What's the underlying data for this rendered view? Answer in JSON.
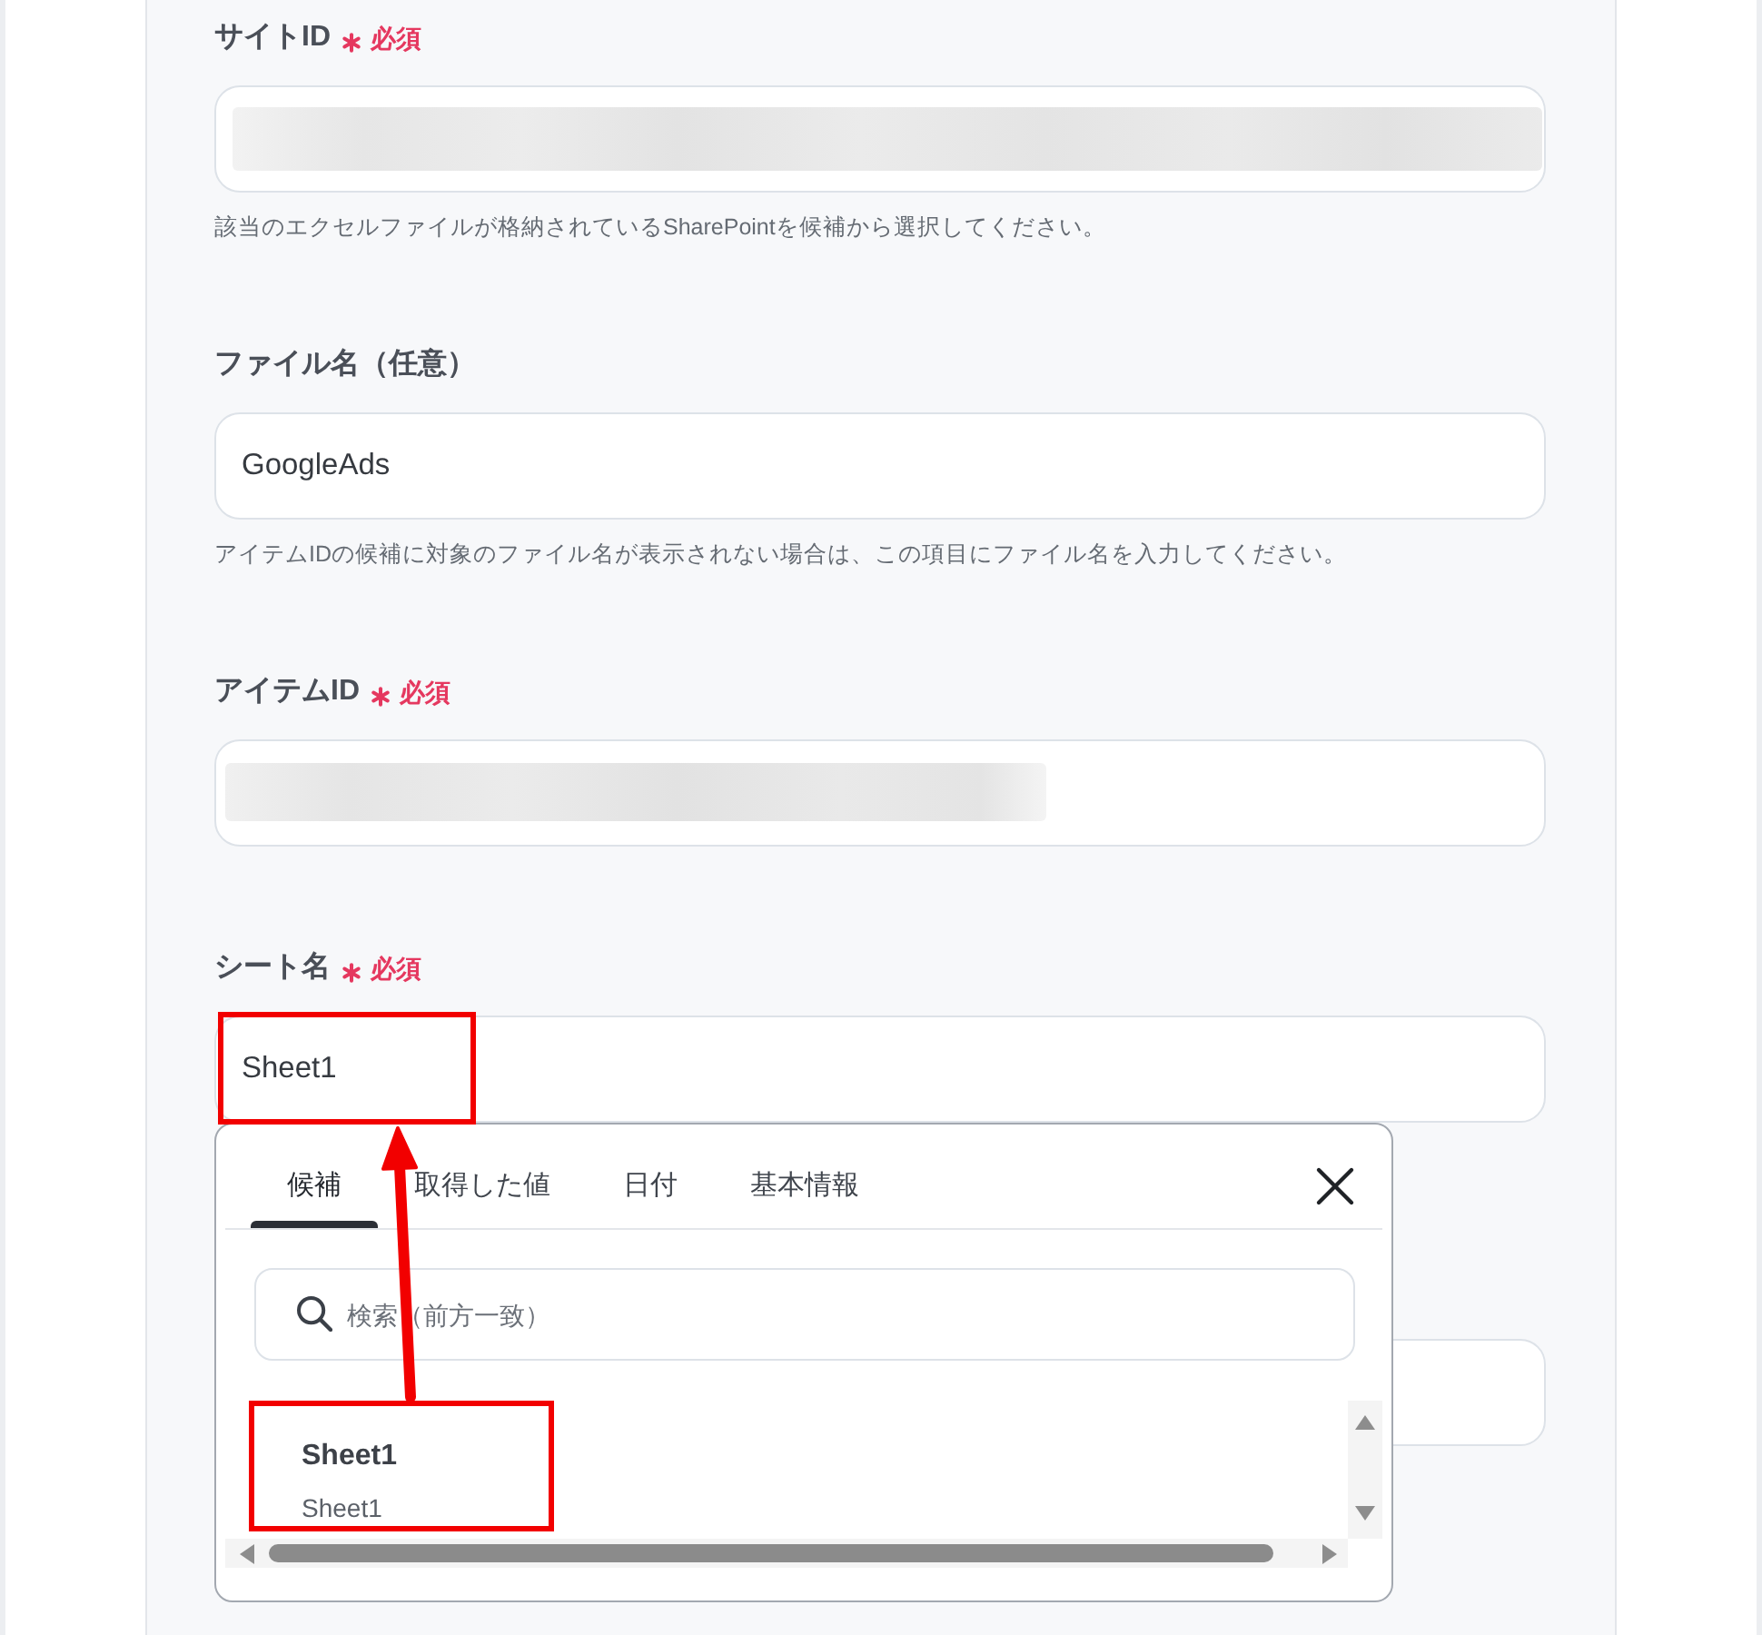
{
  "fields": [
    {
      "kind": "redacted",
      "label": "サイトID",
      "required_text": "必須",
      "highlighted": false,
      "hint": "該当のエクセルファイルが格納されているSharePointを候補から選択してください。"
    },
    {
      "kind": "text",
      "label": "ファイル名（任意）",
      "value": "GoogleAds",
      "highlighted": false,
      "hint": "アイテムIDの候補に対象のファイル名が表示されない場合は、この項目にファイル名を入力してください。"
    },
    {
      "kind": "redacted",
      "label": "アイテムID",
      "required_text": "必須",
      "highlighted": false
    },
    {
      "kind": "text",
      "label": "シート名",
      "required_text": "必須",
      "value": "Sheet1",
      "highlighted": true,
      "dropdown": {
        "tabs": [
          {
            "label": "候補",
            "selected": true
          },
          {
            "label": "取得した値",
            "selected": false
          },
          {
            "label": "日付",
            "selected": false
          },
          {
            "label": "基本情報",
            "selected": false
          }
        ],
        "search": {
          "placeholder": "検索（前方一致）"
        },
        "items": [
          {
            "title": "Sheet1",
            "subtitle": "Sheet1",
            "highlighted": true
          }
        ],
        "callout_arrow": true
      }
    },
    {
      "kind": "text",
      "highlighted": false
    }
  ]
}
